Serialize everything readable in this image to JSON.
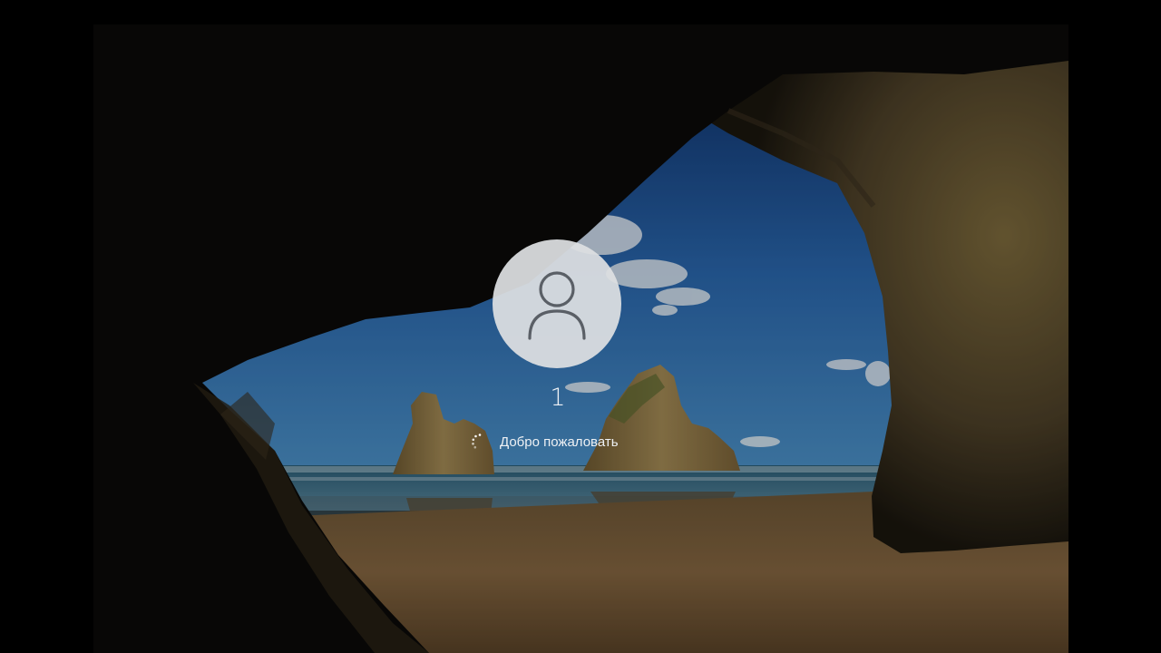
{
  "lockscreen": {
    "background": "cave-beach-wallpaper",
    "avatar_icon": "user-icon",
    "username": "1",
    "status_icon": "loading-spinner-icon",
    "status_text": "Добро пожаловать"
  },
  "colors": {
    "sky_top": "#0d2f6b",
    "sky_bottom": "#3f86c4",
    "sea": "#1f4e66",
    "sand": "#8a6a3e",
    "rock": "#8c7442",
    "cave": "#0b0a08",
    "avatar_bg": "#dfe1e3",
    "avatar_glyph": "#5a5f66",
    "text": "#eef1f4"
  }
}
